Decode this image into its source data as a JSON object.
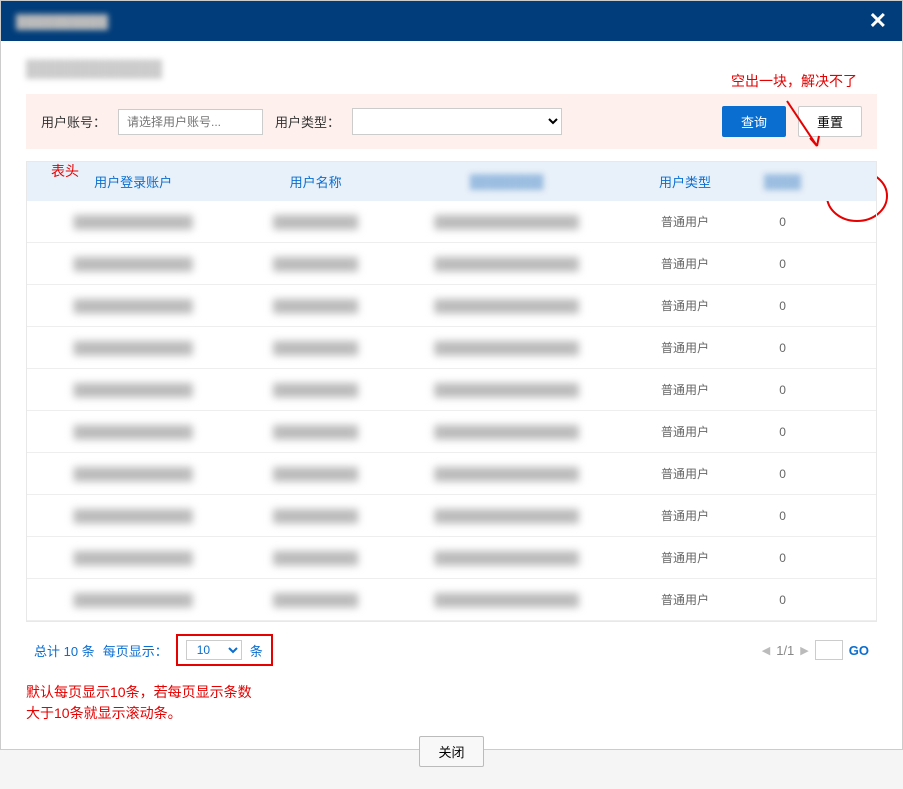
{
  "header": {
    "title": "██████████",
    "close_icon": "✕"
  },
  "subtitle": "████████████",
  "annotations": {
    "top_right": "空出一块，解决不了",
    "table_head_label": "表头",
    "bottom_line1": "默认每页显示10条，若每页显示条数",
    "bottom_line2": "大于10条就显示滚动条。"
  },
  "filter": {
    "account_label": "用户账号：",
    "account_placeholder": "请选择用户账号...",
    "type_label": "用户类型：",
    "query_btn": "查询",
    "reset_btn": "重置"
  },
  "table": {
    "headers": {
      "c0": "用户登录账户",
      "c1": "用户名称",
      "c2_hidden": "████████",
      "c3": "用户类型",
      "c4_hidden": "████",
      "c5_hidden": ""
    },
    "rows": [
      {
        "c0": "██████████████",
        "c1": "██████████",
        "c2": "█████████████████",
        "c3": "普通用户",
        "c4": "0"
      },
      {
        "c0": "██████████████",
        "c1": "██████████",
        "c2": "█████████████████",
        "c3": "普通用户",
        "c4": "0"
      },
      {
        "c0": "██████████████",
        "c1": "██████████",
        "c2": "█████████████████",
        "c3": "普通用户",
        "c4": "0"
      },
      {
        "c0": "██████████████",
        "c1": "██████████",
        "c2": "█████████████████",
        "c3": "普通用户",
        "c4": "0"
      },
      {
        "c0": "██████████████",
        "c1": "██████████",
        "c2": "█████████████████",
        "c3": "普通用户",
        "c4": "0"
      },
      {
        "c0": "██████████████",
        "c1": "██████████",
        "c2": "█████████████████",
        "c3": "普通用户",
        "c4": "0"
      },
      {
        "c0": "██████████████",
        "c1": "██████████",
        "c2": "█████████████████",
        "c3": "普通用户",
        "c4": "0"
      },
      {
        "c0": "██████████████",
        "c1": "██████████",
        "c2": "█████████████████",
        "c3": "普通用户",
        "c4": "0"
      },
      {
        "c0": "██████████████",
        "c1": "██████████",
        "c2": "█████████████████",
        "c3": "普通用户",
        "c4": "0"
      },
      {
        "c0": "██████████████",
        "c1": "██████████",
        "c2": "█████████████████",
        "c3": "普通用户",
        "c4": "0"
      }
    ]
  },
  "pagination": {
    "total_text": "总计 10 条",
    "per_page_label": "每页显示：",
    "per_page_value": "10",
    "per_page_suffix": "条",
    "page_current": "1/1",
    "go_label": "GO"
  },
  "footer": {
    "close_btn": "关闭"
  }
}
